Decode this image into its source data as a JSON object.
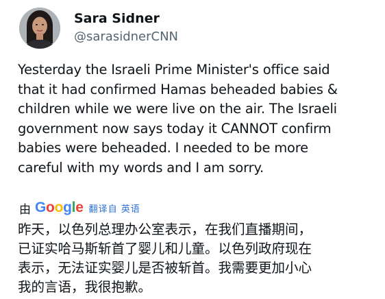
{
  "author": {
    "display_name": "Sara Sidner",
    "handle": "@sarasidnerCNN",
    "avatar_icon": "profile-photo"
  },
  "tweet": {
    "text": "Yesterday the Israeli Prime Minister's office said\nthat it had confirmed Hamas beheaded babies &\nchildren while we were live on the air. The Israeli\ngovernment now says today it CANNOT confirm\nbabies were beheaded.  I needed to be more\ncareful with my words and I am sorry."
  },
  "translation": {
    "by_label": "由",
    "google_letters": [
      "G",
      "o",
      "o",
      "g",
      "l",
      "e"
    ],
    "google_colors": [
      "#4285F4",
      "#EA4335",
      "#FBBC05",
      "#4285F4",
      "#34A853",
      "#EA4335"
    ],
    "translate_label": "翻译自 英语",
    "text": "昨天，以色列总理办公室表示，在我们直播期间，\n已证实哈马斯斩首了婴儿和儿童。以色列政府现在\n表示，无法证实婴儿是否被斩首。我需要更加小心\n我的言语，我很抱歉。"
  }
}
